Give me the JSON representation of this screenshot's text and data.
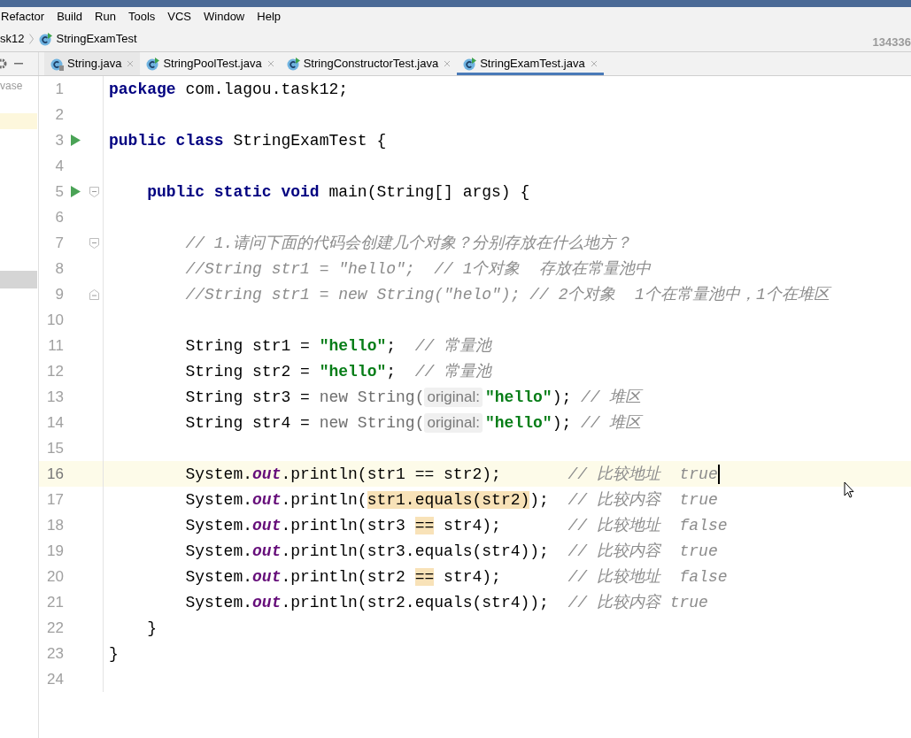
{
  "menu": [
    "Refactor",
    "Build",
    "Run",
    "Tools",
    "VCS",
    "Window",
    "Help"
  ],
  "breadcrumb": {
    "items": [
      "sk12",
      "StringExamTest"
    ],
    "right_text": "134336"
  },
  "project_panel": {
    "items": [
      "vase"
    ]
  },
  "tabs": [
    {
      "label": "String.java",
      "kind": "library",
      "selected": false
    },
    {
      "label": "StringPoolTest.java",
      "kind": "class",
      "selected": false
    },
    {
      "label": "StringConstructorTest.java",
      "kind": "class",
      "selected": false
    },
    {
      "label": "StringExamTest.java",
      "kind": "class",
      "selected": true
    }
  ],
  "editor": {
    "lines": [
      {
        "number": "1",
        "current": false,
        "tokens": [
          {
            "kind": "keyword",
            "text": "package"
          },
          {
            "kind": "plain",
            "text": " com.lagou.task12;"
          }
        ]
      },
      {
        "number": "2",
        "current": false
      },
      {
        "number": "3",
        "current": false,
        "gutter_icons": [
          {
            "kind": "run"
          }
        ],
        "tokens": [
          {
            "kind": "keyword",
            "text": "public class"
          },
          {
            "kind": "plain",
            "text": " StringExamTest {"
          }
        ]
      },
      {
        "number": "4",
        "current": false
      },
      {
        "number": "5",
        "current": false,
        "gutter_icons": [
          {
            "kind": "run"
          },
          {
            "kind": "fold_start"
          }
        ],
        "tokens": [
          {
            "kind": "keyword",
            "text": "    public static void"
          },
          {
            "kind": "plain",
            "text": " main(String[] args) {"
          }
        ]
      },
      {
        "number": "6",
        "current": false
      },
      {
        "number": "7",
        "current": false,
        "gutter_icons": [
          {
            "kind": "fold_start"
          }
        ],
        "tokens": [
          {
            "kind": "comment",
            "text": "        // 1.请问下面的代码会创建几个对象？分别存放在什么地方？"
          }
        ]
      },
      {
        "number": "8",
        "current": false,
        "tokens": [
          {
            "kind": "comment",
            "text": "        //String str1 = \"hello\";  // 1个对象  存放在常量池中"
          }
        ]
      },
      {
        "number": "9",
        "current": false,
        "gutter_icons": [
          {
            "kind": "fold_end"
          }
        ],
        "tokens": [
          {
            "kind": "comment",
            "text": "        //String str1 = new String(\"helo\"); // 2个对象  1个在常量池中，1个在堆区"
          }
        ]
      },
      {
        "number": "10",
        "current": false
      },
      {
        "number": "11",
        "current": false,
        "tokens": [
          {
            "kind": "plain",
            "text": "        String str1 = "
          },
          {
            "kind": "string",
            "text": "\"hello\""
          },
          {
            "kind": "plain",
            "text": ";  "
          },
          {
            "kind": "comment",
            "text": "// 常量池"
          }
        ]
      },
      {
        "number": "12",
        "current": false,
        "tokens": [
          {
            "kind": "plain",
            "text": "        String str2 = "
          },
          {
            "kind": "string",
            "text": "\"hello\""
          },
          {
            "kind": "plain",
            "text": ";  "
          },
          {
            "kind": "comment",
            "text": "// 常量池"
          }
        ]
      },
      {
        "number": "13",
        "current": false,
        "tokens": [
          {
            "kind": "plain",
            "text": "        String str3 = "
          },
          {
            "kind": "dim",
            "text": "new String("
          },
          {
            "kind": "hint",
            "text": "original:"
          },
          {
            "kind": "string",
            "text": "\"hello\""
          },
          {
            "kind": "plain",
            "text": "); "
          },
          {
            "kind": "comment",
            "text": "// 堆区"
          }
        ]
      },
      {
        "number": "14",
        "current": false,
        "tokens": [
          {
            "kind": "plain",
            "text": "        String str4 = "
          },
          {
            "kind": "dim",
            "text": "new String("
          },
          {
            "kind": "hint",
            "text": "original:"
          },
          {
            "kind": "string",
            "text": "\"hello\""
          },
          {
            "kind": "plain",
            "text": "); "
          },
          {
            "kind": "comment",
            "text": "// 堆区"
          }
        ]
      },
      {
        "number": "15",
        "current": false
      },
      {
        "number": "16",
        "current": true,
        "tokens": [
          {
            "kind": "plain",
            "text": "        System."
          },
          {
            "kind": "field",
            "text": "out"
          },
          {
            "kind": "plain",
            "text": ".println(str1 == str2);       "
          },
          {
            "kind": "comment",
            "text": "// 比较地址  true"
          }
        ]
      },
      {
        "number": "17",
        "current": false,
        "tokens": [
          {
            "kind": "plain",
            "text": "        System."
          },
          {
            "kind": "field",
            "text": "out"
          },
          {
            "kind": "plain",
            "text": ".println("
          },
          {
            "kind": "match",
            "text": "str1.equals(str2)"
          },
          {
            "kind": "plain",
            "text": ");  "
          },
          {
            "kind": "comment",
            "text": "// 比较内容  true"
          }
        ]
      },
      {
        "number": "18",
        "current": false,
        "tokens": [
          {
            "kind": "plain",
            "text": "        System."
          },
          {
            "kind": "field",
            "text": "out"
          },
          {
            "kind": "plain",
            "text": ".println(str3 "
          },
          {
            "kind": "match",
            "text": "=="
          },
          {
            "kind": "plain",
            "text": " str4);       "
          },
          {
            "kind": "comment",
            "text": "// 比较地址  false"
          }
        ]
      },
      {
        "number": "19",
        "current": false,
        "tokens": [
          {
            "kind": "plain",
            "text": "        System."
          },
          {
            "kind": "field",
            "text": "out"
          },
          {
            "kind": "plain",
            "text": ".println(str3.equals(str4));  "
          },
          {
            "kind": "comment",
            "text": "// 比较内容  true"
          }
        ]
      },
      {
        "number": "20",
        "current": false,
        "tokens": [
          {
            "kind": "plain",
            "text": "        System."
          },
          {
            "kind": "field",
            "text": "out"
          },
          {
            "kind": "plain",
            "text": ".println(str2 "
          },
          {
            "kind": "match",
            "text": "=="
          },
          {
            "kind": "plain",
            "text": " str4);       "
          },
          {
            "kind": "comment",
            "text": "// 比较地址  false"
          }
        ]
      },
      {
        "number": "21",
        "current": false,
        "tokens": [
          {
            "kind": "plain",
            "text": "        System."
          },
          {
            "kind": "field",
            "text": "out"
          },
          {
            "kind": "plain",
            "text": ".println(str2.equals(str4));  "
          },
          {
            "kind": "comment",
            "text": "// 比较内容 true"
          }
        ]
      },
      {
        "number": "22",
        "current": false,
        "tokens": [
          {
            "kind": "plain",
            "text": "    }"
          }
        ]
      },
      {
        "number": "23",
        "current": false,
        "tokens": [
          {
            "kind": "plain",
            "text": "}"
          }
        ]
      },
      {
        "number": "24",
        "current": false
      }
    ]
  }
}
